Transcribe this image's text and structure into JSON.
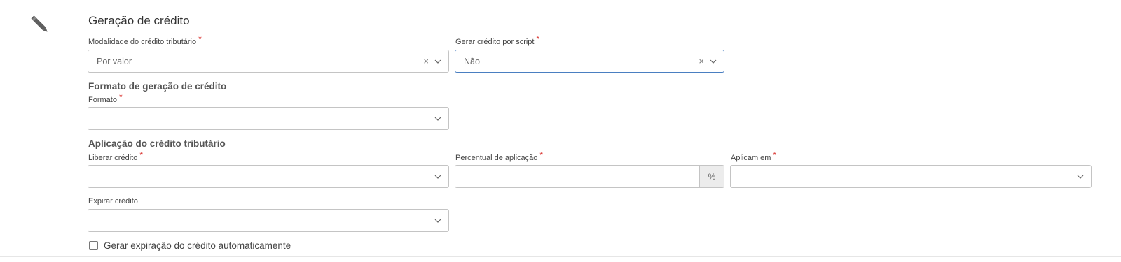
{
  "section": {
    "title": "Geração de crédito",
    "icon": "pencil-icon"
  },
  "modalidade": {
    "label": "Modalidade do crédito tributário",
    "required": "*",
    "value": "Por valor",
    "clear": "×"
  },
  "gerar_script": {
    "label": "Gerar crédito por script",
    "required": "*",
    "value": "Não",
    "clear": "×"
  },
  "formato_section": {
    "title": "Formato de geração de crédito"
  },
  "formato": {
    "label": "Formato",
    "required": "*",
    "value": ""
  },
  "aplicacao_section": {
    "title": "Aplicação do crédito tributário"
  },
  "liberar": {
    "label": "Liberar crédito",
    "required": "*",
    "value": ""
  },
  "percentual": {
    "label": "Percentual de aplicação",
    "required": "*",
    "value": "",
    "addon": "%"
  },
  "aplicam_em": {
    "label": "Aplicam em",
    "required": "*",
    "value": ""
  },
  "expirar": {
    "label": "Expirar crédito",
    "value": ""
  },
  "auto_expire": {
    "label": "Gerar expiração do crédito automaticamente",
    "checked": false
  }
}
